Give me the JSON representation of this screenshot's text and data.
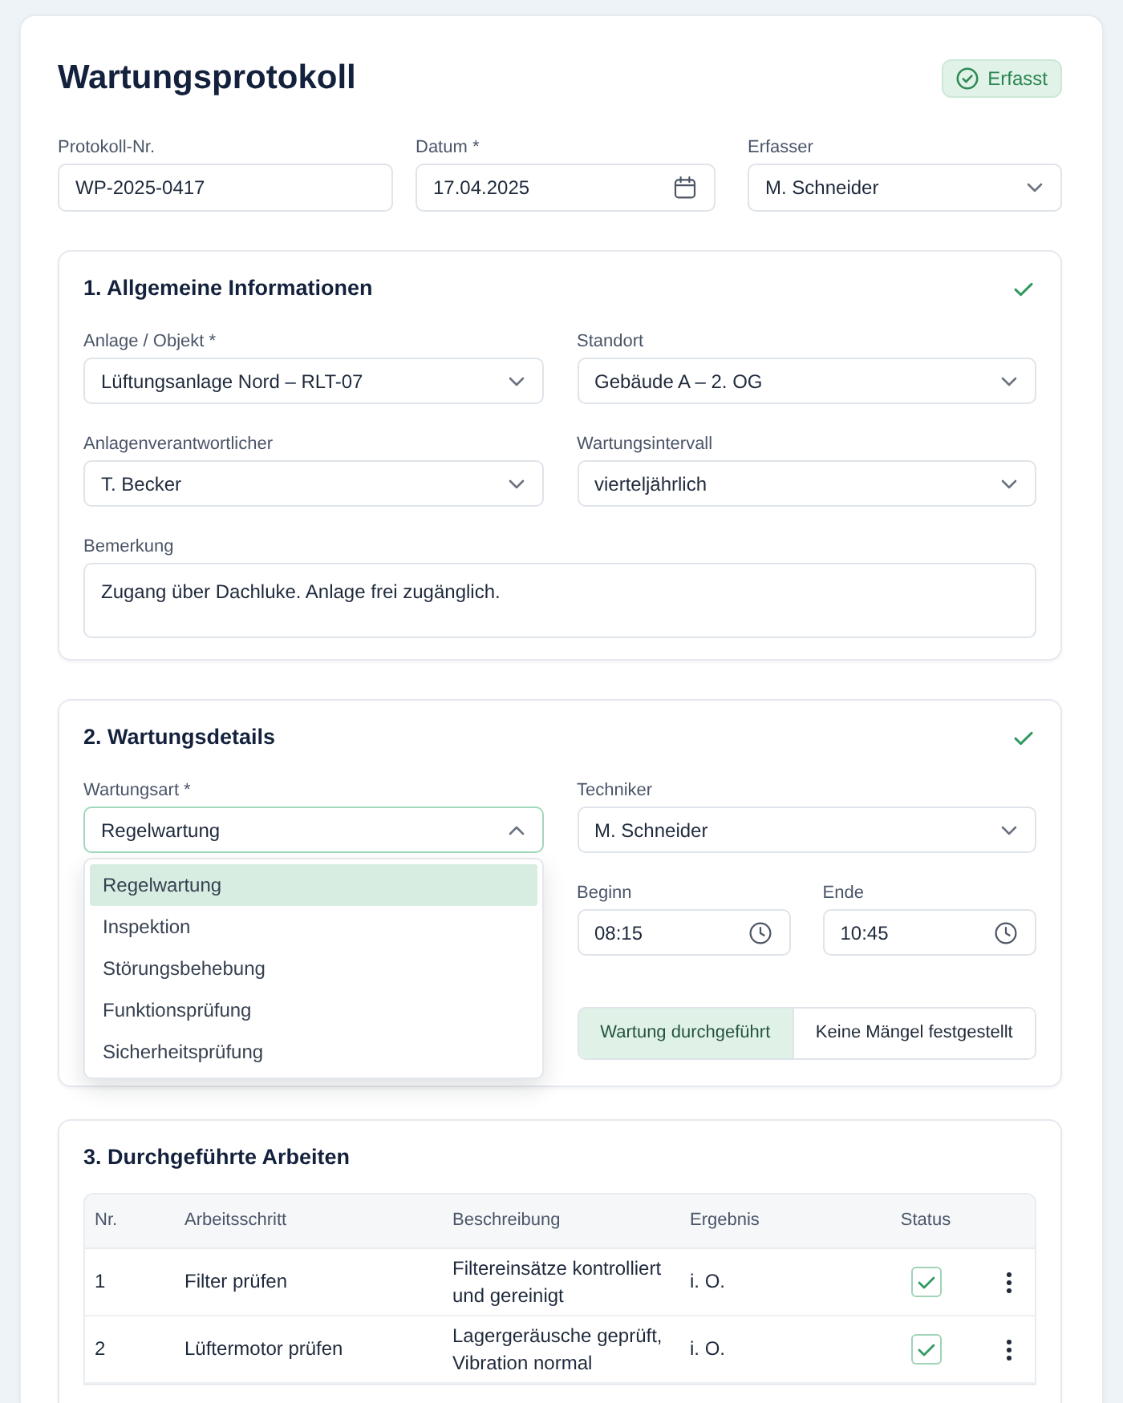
{
  "header": {
    "title": "Wartungsprotokoll",
    "status_badge": {
      "label": "Erfasst"
    }
  },
  "top_fields": [
    {
      "label": "Protokoll-Nr.",
      "kind": "text",
      "value": "WP-2025-0417"
    },
    {
      "label": "Datum *",
      "kind": "date",
      "value": "17.04.2025"
    },
    {
      "label": "Erfasser",
      "kind": "select",
      "value": "M. Schneider",
      "expanded": false
    }
  ],
  "general_info": {
    "title": "1. Allgemeine Informationen",
    "complete": true,
    "fields": [
      {
        "label": "Anlage / Objekt *",
        "kind": "select",
        "value": "Lüftungsanlage Nord – RLT-07",
        "expanded": false
      },
      {
        "label": "Standort",
        "kind": "select",
        "value": "Gebäude A – 2. OG",
        "expanded": false
      },
      {
        "label": "Anlagenverantwortlicher",
        "kind": "select",
        "value": "T. Becker",
        "expanded": false
      },
      {
        "label": "Wartungsintervall",
        "kind": "select",
        "value": "vierteljährlich",
        "expanded": false
      },
      {
        "label": "Bemerkung",
        "kind": "textarea",
        "value": "Zugang über Dachluke. Anlage frei zugänglich."
      }
    ]
  },
  "maintenance_details": {
    "title": "2. Wartungsdetails",
    "complete": true,
    "fields": [
      {
        "label": "Wartungsart *",
        "kind": "select",
        "value": "Regelwartung",
        "expanded": true,
        "options": [
          {
            "label": "Regelwartung",
            "selected": true
          },
          {
            "label": "Inspektion",
            "selected": false
          },
          {
            "label": "Störungsbehebung",
            "selected": false
          },
          {
            "label": "Funktionsprüfung",
            "selected": false
          },
          {
            "label": "Sicherheitsprüfung",
            "selected": false
          }
        ]
      },
      {
        "label": "Techniker",
        "kind": "select",
        "value": "M. Schneider",
        "expanded": false
      },
      {
        "label": "Beginn",
        "kind": "time",
        "value": "08:15"
      },
      {
        "label": "Ende",
        "kind": "time",
        "value": "10:45"
      }
    ],
    "toggles": [
      {
        "label": "Wartung durchgeführt",
        "selected": true
      },
      {
        "label": "Keine Mängel festgestellt",
        "selected": false
      }
    ]
  },
  "work_performed": {
    "title": "3. Durchgeführte Arbeiten",
    "table": {
      "columns": [
        "Nr.",
        "Arbeitsschritt",
        "Beschreibung",
        "Ergebnis",
        "Status"
      ],
      "rows": [
        {
          "nr": "1",
          "step": "Filter prüfen",
          "description": "Filtereinsätze kontrolliert und gereinigt",
          "result": "i. O.",
          "checked": true
        },
        {
          "nr": "2",
          "step": "Lüftermotor prüfen",
          "description": "Lagergeräusche geprüft, Vibration normal",
          "result": "i. O.",
          "checked": true
        }
      ]
    }
  }
}
